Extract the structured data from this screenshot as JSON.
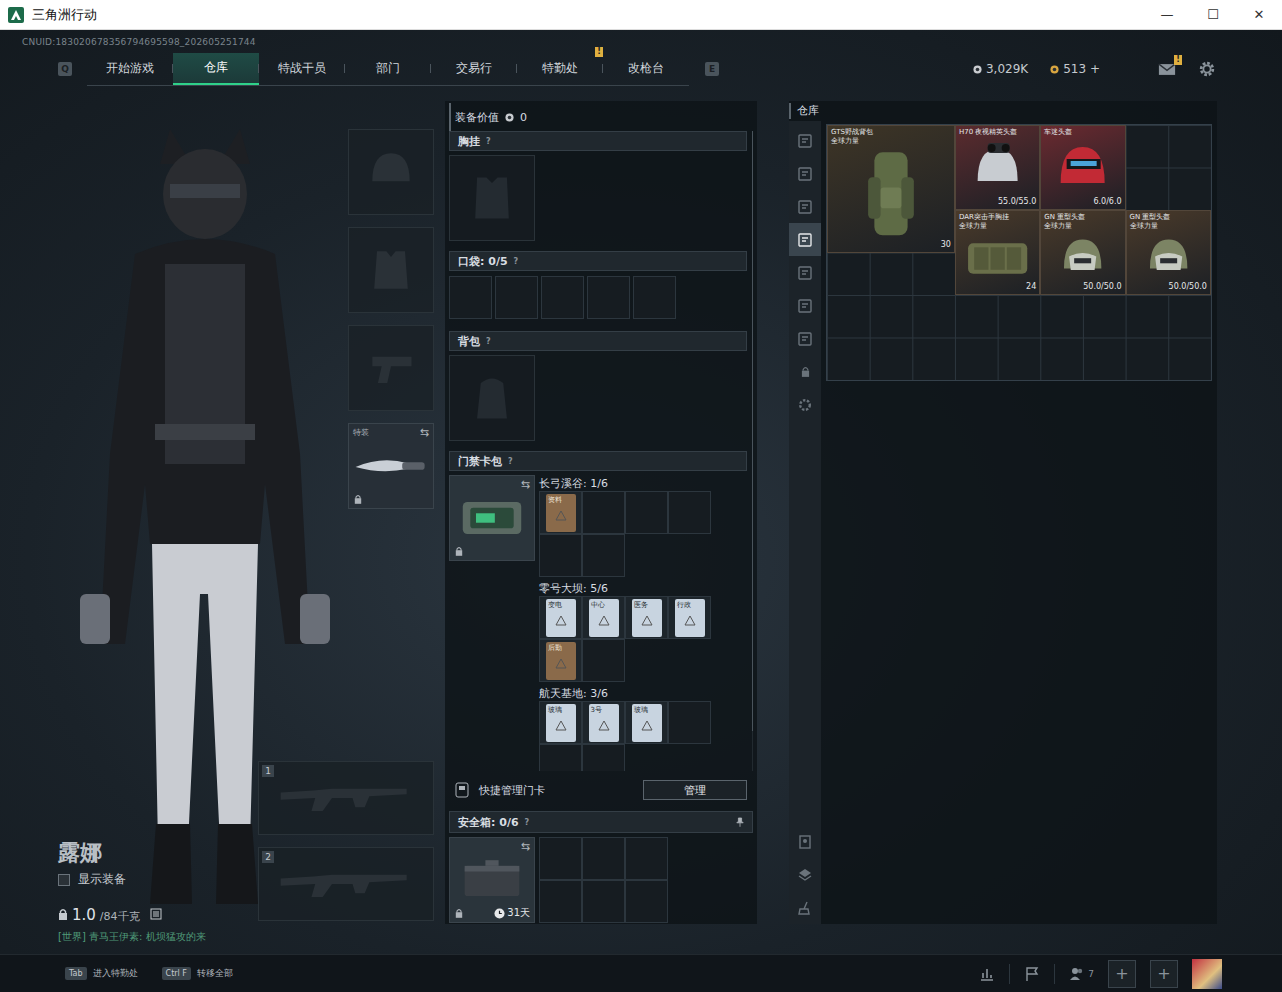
{
  "window": {
    "title": "三角洲行动",
    "controls": [
      "—",
      "☐",
      "✕"
    ]
  },
  "uid": "CNUID:183020678356794695598_202605251744",
  "nav": {
    "left_key": "Q",
    "right_key": "E",
    "tabs": [
      {
        "label": "开始游戏",
        "selected": false,
        "badge": ""
      },
      {
        "label": "仓库",
        "selected": true,
        "badge": ""
      },
      {
        "label": "特战干员",
        "selected": false,
        "badge": ""
      },
      {
        "label": "部门",
        "selected": false,
        "badge": ""
      },
      {
        "label": "交易行",
        "selected": false,
        "badge": ""
      },
      {
        "label": "特勤处",
        "selected": false,
        "badge": "!"
      },
      {
        "label": "改枪台",
        "selected": false,
        "badge": ""
      }
    ]
  },
  "currencies": [
    {
      "amount": "3,029K",
      "color": "#c9ccd0"
    },
    {
      "amount": "513 +",
      "color": "#d9a640"
    }
  ],
  "mail": {
    "badge": "!"
  },
  "operator": {
    "name": "露娜",
    "show_gear": {
      "label": "显示装备",
      "checked": false
    },
    "weight": "1.0",
    "weight_max": "/84千克",
    "chat": "[世界] 青马王伊素: 机坝猛攻的来"
  },
  "gear_slots": [
    {
      "kind": "helmet",
      "label": "",
      "locked": false,
      "swap": ""
    },
    {
      "kind": "armor",
      "label": "",
      "locked": false,
      "swap": ""
    },
    {
      "kind": "pistol",
      "label": "",
      "locked": false,
      "swap": ""
    },
    {
      "kind": "melee",
      "label": "特装",
      "locked": true,
      "swap": "⇆"
    }
  ],
  "weapon_slots": [
    {
      "number": "1"
    },
    {
      "number": "2"
    }
  ],
  "loadout": {
    "value_label": "装备价值",
    "value": "0",
    "chest": {
      "label": "胸挂",
      "help": "?"
    },
    "pockets": {
      "label": "口袋: 0/5",
      "help": "?",
      "slots": 5
    },
    "backpack": {
      "label": "背包",
      "help": "?"
    },
    "keycards": {
      "label": "门禁卡包",
      "help": "?",
      "swap": "⇆",
      "locked": true,
      "maps": [
        {
          "label": "长弓溪谷: 1/6",
          "slots": 6,
          "cards": [
            {
              "label": "资料",
              "color": "#8a6a4a"
            }
          ]
        },
        {
          "label": "零号大坝: 5/6",
          "slots": 6,
          "cards": [
            {
              "label": "变电",
              "color": "#c8d4e0"
            },
            {
              "label": "中心",
              "color": "#c8d4e0"
            },
            {
              "label": "医务",
              "color": "#c8d4e0"
            },
            {
              "label": "行政",
              "color": "#c8d4e0"
            },
            {
              "label": "后勤",
              "color": "#8a6a4a"
            }
          ]
        },
        {
          "label": "航天基地: 3/6",
          "slots": 6,
          "cards": [
            {
              "label": "玻璃",
              "color": "#c8d4e0"
            },
            {
              "label": "3号",
              "color": "#c8d4e0"
            },
            {
              "label": "玻璃",
              "color": "#c8d4e0"
            }
          ]
        }
      ]
    },
    "quick_manage": {
      "label": "快捷管理门卡",
      "button": "管理"
    },
    "safe": {
      "label": "安全箱: 0/6",
      "help": "?",
      "slots": 6,
      "days": "31天",
      "swap": "⇆",
      "locked": true
    }
  },
  "warehouse": {
    "title": "仓库",
    "tabs": [
      {
        "selected": false
      },
      {
        "selected": false
      },
      {
        "selected": false
      },
      {
        "selected": true
      },
      {
        "selected": false
      },
      {
        "selected": false
      },
      {
        "selected": false
      }
    ],
    "items": [
      {
        "kind": "backpack",
        "name": "GTS野战背包",
        "brand": "全球力量",
        "stat": "30",
        "color": "#3e3526"
      },
      {
        "kind": "helmet",
        "name": "H70 夜视精英头盔",
        "brand": "",
        "stat": "55.0/55.0",
        "color": "#5b2b2e"
      },
      {
        "kind": "redhelmet",
        "name": "车迷头盔",
        "brand": "",
        "stat": "6.0/6.0",
        "color": "#6b2a30"
      },
      {
        "kind": "rig",
        "name": "DAR突击手胸挂",
        "brand": "全球力量",
        "stat": "24",
        "color": "#4a3a2a"
      },
      {
        "kind": "heavyhelmet",
        "name": "GN 重型头盔",
        "brand": "全球力量",
        "stat": "50.0/50.0",
        "color": "#4a3a2a"
      },
      {
        "kind": "heavyhelmet",
        "name": "GN 重型头盔",
        "brand": "全球力量",
        "stat": "50.0/50.0",
        "color": "#4a3a2a"
      }
    ]
  },
  "bottom_bar": {
    "hints": [
      {
        "key": "Tab",
        "label": "进入特勤处"
      },
      {
        "key": "Ctrl F",
        "label": "转移全部"
      }
    ],
    "friends": "7",
    "add_slots": [
      "+",
      "+"
    ]
  }
}
